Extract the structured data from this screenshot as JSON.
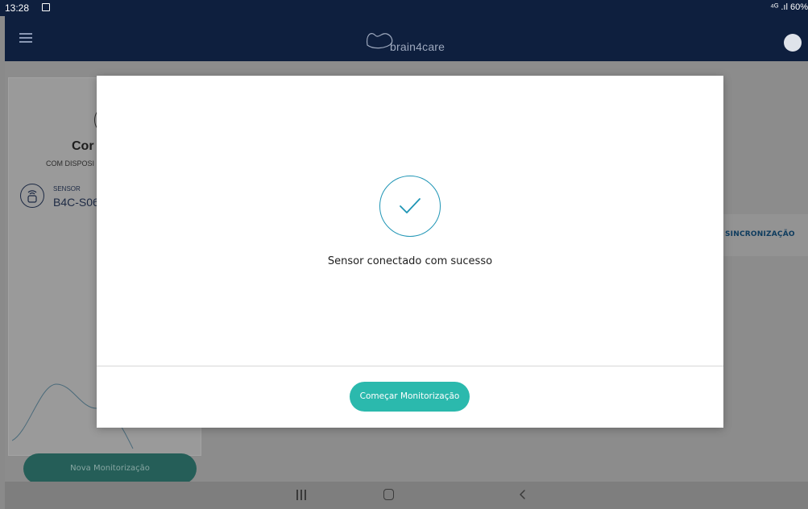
{
  "status_bar": {
    "time": "13:28",
    "right_text": "⁴ᴳ .ıl 60%"
  },
  "app_bar": {
    "logo_text": "brain4care"
  },
  "background": {
    "title_partial": "Cor",
    "subtitle_partial": "COM DISPOSI",
    "sensor_label": "SENSOR",
    "sensor_value": "B4C-S06",
    "sync_label": "SINCRONIZAÇÃO",
    "new_monitoring_button": "Nova Monitorização"
  },
  "modal": {
    "message": "Sensor conectado com sucesso",
    "start_button": "Começar Monitorização"
  },
  "colors": {
    "app_bar": "#0e1f3e",
    "primary_teal": "#2bb9ad",
    "check_blue": "#1f95b5"
  }
}
